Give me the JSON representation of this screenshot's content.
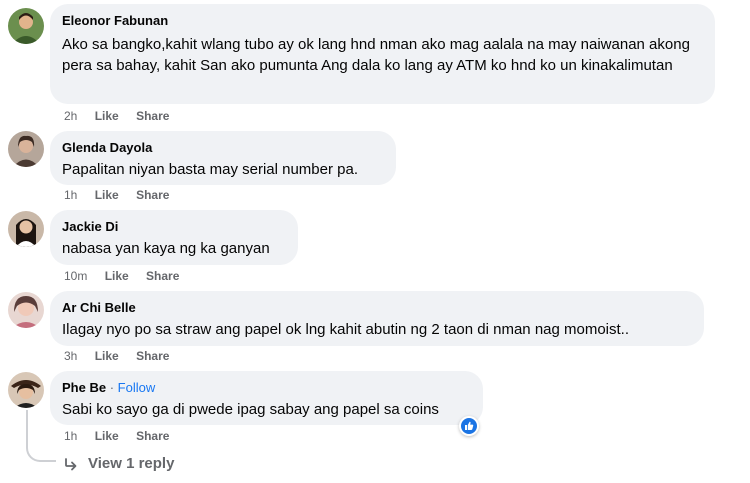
{
  "comments": [
    {
      "name": "Eleonor Fabunan",
      "text": "Ako sa bangko,kahit wlang tubo ay ok lang hnd nman ako mag aalala na may naiwanan akong pera sa bahay, kahit San ako pumunta Ang dala ko lang ay ATM ko hnd ko un kinakalimutan",
      "time": "2h",
      "like": "Like",
      "share": "Share"
    },
    {
      "name": "Glenda Dayola",
      "text": "Papalitan niyan basta may serial number pa.",
      "time": "1h",
      "like": "Like",
      "share": "Share"
    },
    {
      "name": "Jackie Di",
      "text": "nabasa yan kaya ng ka ganyan",
      "time": "10m",
      "like": "Like",
      "share": "Share"
    },
    {
      "name": "Ar Chi Belle",
      "text": "Ilagay nyo po sa straw ang papel ok lng kahit abutin ng 2 taon di nman nag momoist..",
      "time": "3h",
      "like": "Like",
      "share": "Share"
    },
    {
      "name": "Phe Be",
      "follow_separator": "·",
      "follow": "Follow",
      "text": "Sabi ko sayo ga di pwede ipag sabay ang papel sa coins",
      "time": "1h",
      "like": "Like",
      "share": "Share"
    }
  ],
  "view_replies": "View 1 reply",
  "colors": {
    "bubble": "#f0f2f5",
    "meta": "#65676b",
    "link": "#1877f2",
    "like_badge": "#1b74e4"
  },
  "icons": [
    "avatar",
    "like-reaction-icon",
    "reply-arrow-icon"
  ]
}
